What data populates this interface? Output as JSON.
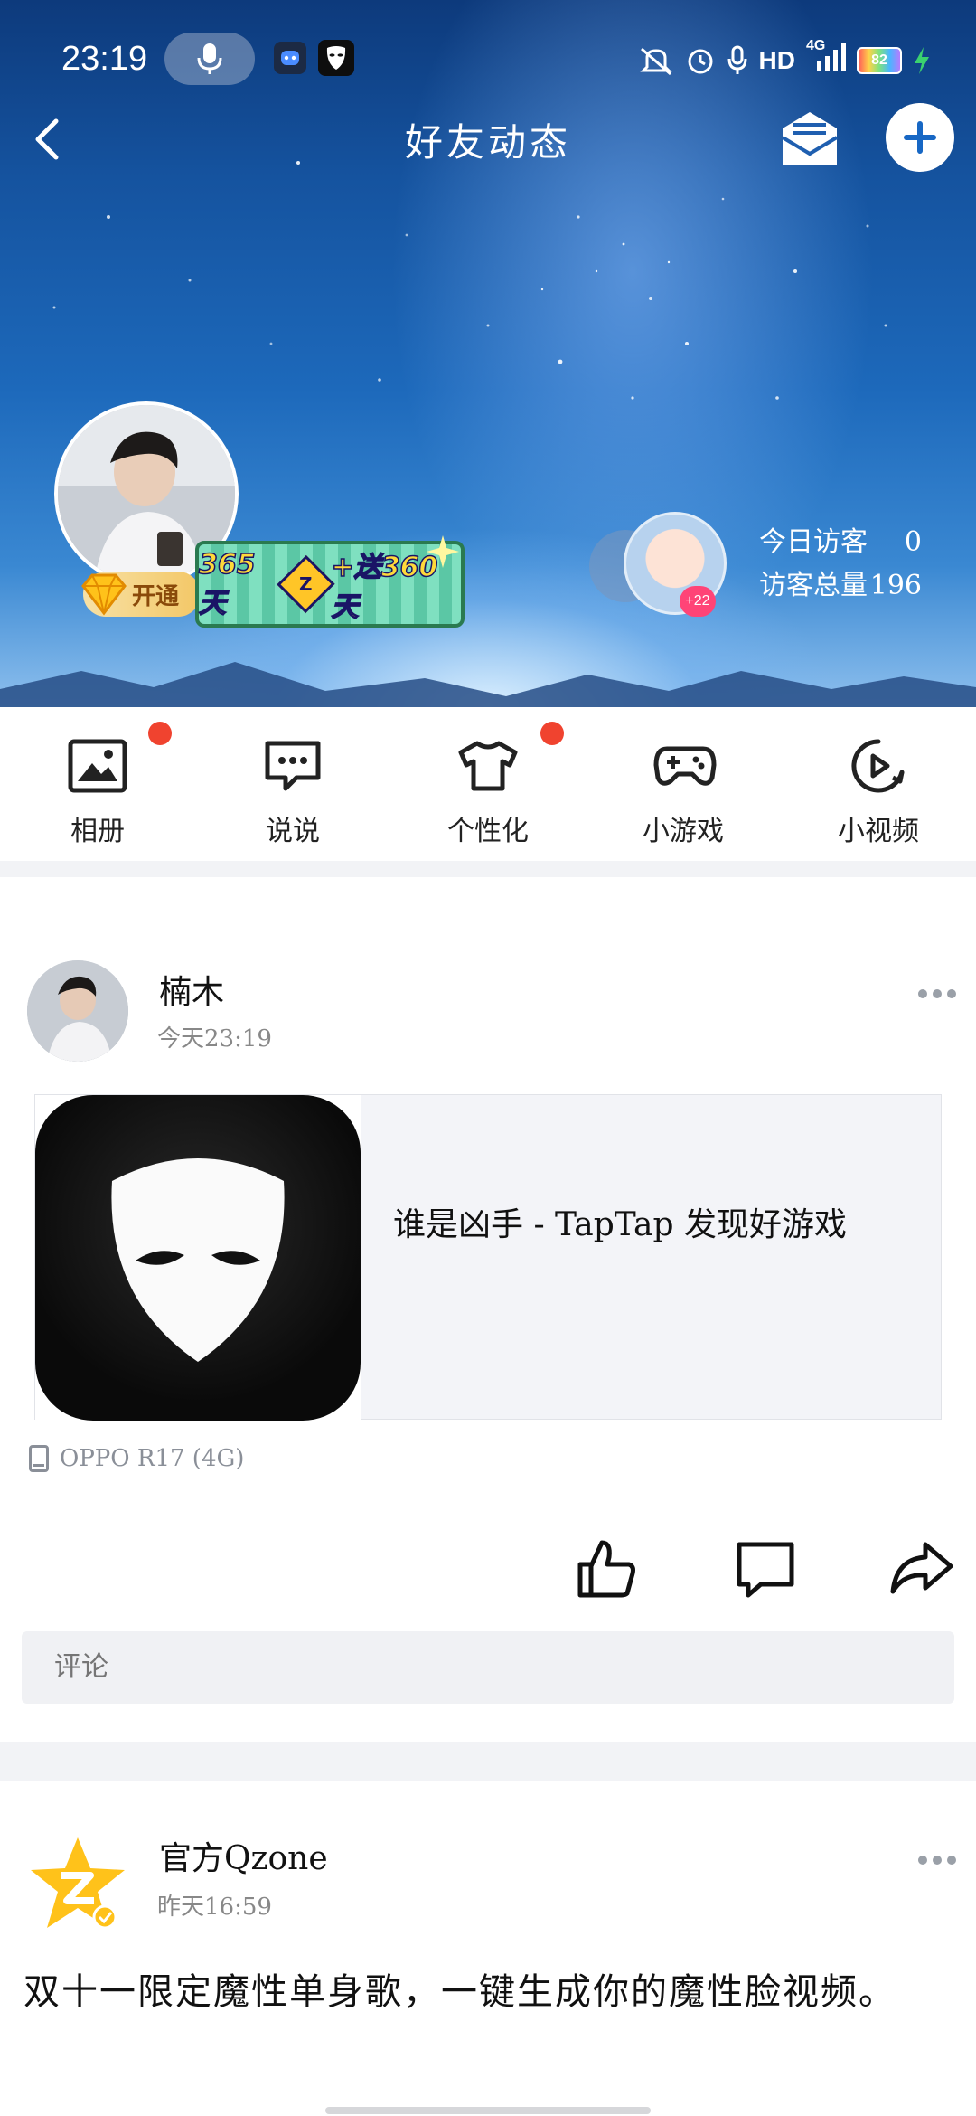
{
  "status_bar": {
    "time": "23:19",
    "network": "HD",
    "signal_type": "4G",
    "battery": "82",
    "icons": [
      "mic-icon",
      "app-icon-bot",
      "app-icon-mask",
      "mute-icon",
      "alarm-icon",
      "mic-small-icon",
      "signal-icon",
      "battery-icon",
      "charging-icon"
    ]
  },
  "header": {
    "title": "好友动态",
    "back_icon": "chevron-left-icon",
    "mail_icon": "mail-icon",
    "add_icon": "plus-icon"
  },
  "profile": {
    "vip_label": "开通",
    "promo_text_a": "365天",
    "promo_z": "Z",
    "promo_text_b": "+送360天",
    "visitor_badge": "+22",
    "today_visitors_label": "今日访客",
    "today_visitors_value": "0",
    "total_visitors_label": "访客总量",
    "total_visitors_value": "196"
  },
  "shortcuts": [
    {
      "label": "相册",
      "icon": "photo-icon",
      "dot": true
    },
    {
      "label": "说说",
      "icon": "chat-bubble-icon",
      "dot": false
    },
    {
      "label": "个性化",
      "icon": "tshirt-icon",
      "dot": true
    },
    {
      "label": "小游戏",
      "icon": "gamepad-icon",
      "dot": false
    },
    {
      "label": "小视频",
      "icon": "play-icon",
      "dot": false
    }
  ],
  "feed": [
    {
      "author": "楠木",
      "time": "今天23:19",
      "link_title": "谁是凶手 - TapTap 发现好游戏",
      "device": "OPPO R17 (4G)",
      "comment_placeholder": "评论"
    },
    {
      "author": "官方Qzone",
      "time": "昨天16:59",
      "text": "双十一限定魔性单身歌，一键生成你的魔性脸视频。"
    }
  ],
  "colors": {
    "accent_red": "#f0432f",
    "promo_pink": "#ff4477",
    "text_gray": "#888888"
  }
}
